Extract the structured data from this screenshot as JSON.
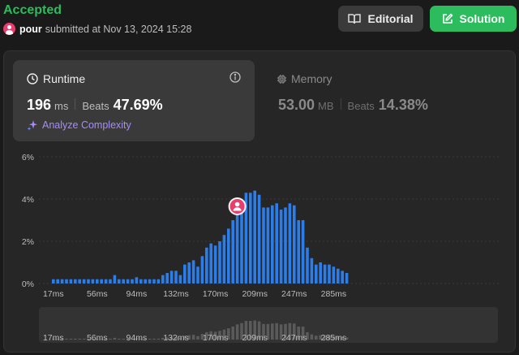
{
  "submission": {
    "status": "Accepted",
    "username": "pour",
    "submitted_text": "submitted at Nov 13, 2024 15:28"
  },
  "actions": {
    "editorial_label": "Editorial",
    "solution_label": "Solution"
  },
  "runtime": {
    "title": "Runtime",
    "value": "196",
    "unit": "ms",
    "beats_label": "Beats",
    "beats_value": "47.69%",
    "analyze_label": "Analyze Complexity"
  },
  "memory": {
    "title": "Memory",
    "value": "53.00",
    "unit": "MB",
    "beats_label": "Beats",
    "beats_value": "14.38%"
  },
  "colors": {
    "accepted": "#2cbb5d",
    "bar": "#2b7de9",
    "bar_dim": "#5a5a5a",
    "avatar": "#e83e6d",
    "analyze": "#a78bfa"
  },
  "chart_data": {
    "type": "bar",
    "title": "",
    "xlabel": "",
    "ylabel": "",
    "ylim": [
      0,
      6
    ],
    "y_ticks": [
      "0%",
      "2%",
      "4%",
      "6%"
    ],
    "x_tick_labels": [
      "17ms",
      "56ms",
      "94ms",
      "132ms",
      "170ms",
      "209ms",
      "247ms",
      "285ms"
    ],
    "x_tick_bar_index": [
      0,
      10,
      19,
      28,
      37,
      46,
      55,
      64
    ],
    "highlight_index": 42,
    "values": [
      0.2,
      0.2,
      0.2,
      0.2,
      0.2,
      0.2,
      0.2,
      0.2,
      0.2,
      0.2,
      0.2,
      0.2,
      0.2,
      0.2,
      0.4,
      0.2,
      0.2,
      0.2,
      0.2,
      0.3,
      0.2,
      0.2,
      0.2,
      0.2,
      0.2,
      0.4,
      0.5,
      0.6,
      0.6,
      0.4,
      0.9,
      1.0,
      1.1,
      0.8,
      1.3,
      1.7,
      1.9,
      1.8,
      2.0,
      2.3,
      2.6,
      3.0,
      3.5,
      3.8,
      4.3,
      4.3,
      4.4,
      4.2,
      3.6,
      3.6,
      3.7,
      3.8,
      3.5,
      3.6,
      3.8,
      3.7,
      3.0,
      3.0,
      1.7,
      1.2,
      0.9,
      1.0,
      0.9,
      0.9,
      0.8,
      0.7,
      0.6,
      0.5
    ]
  }
}
